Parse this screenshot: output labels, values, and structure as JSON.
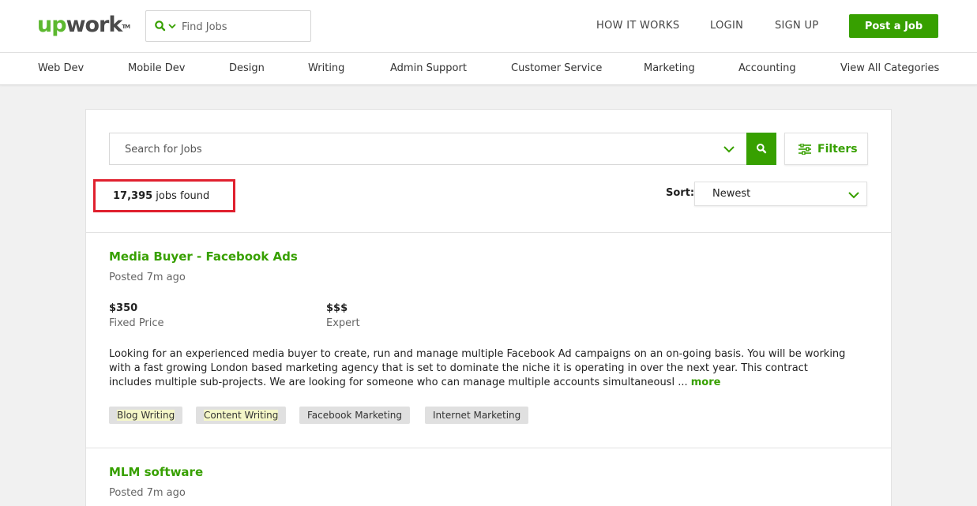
{
  "header": {
    "logo_up": "up",
    "logo_work": "work",
    "logo_tm": "TM",
    "search_placeholder": "Find Jobs",
    "nav": [
      "HOW IT WORKS",
      "LOGIN",
      "SIGN UP"
    ],
    "post_job": "Post a Job"
  },
  "categories": [
    "Web Dev",
    "Mobile Dev",
    "Design",
    "Writing",
    "Admin Support",
    "Customer Service",
    "Marketing",
    "Accounting",
    "View All Categories"
  ],
  "search": {
    "placeholder": "Search for Jobs",
    "filters_label": "Filters"
  },
  "results": {
    "count": "17,395",
    "count_suffix": " jobs found",
    "sort_label": "Sort:",
    "sort_value": "Newest"
  },
  "jobs": [
    {
      "title": "Media Buyer - Facebook Ads",
      "posted": "Posted 7m ago",
      "price": "$350",
      "price_type": "Fixed Price",
      "level_symbol": "$$$",
      "level": "Expert",
      "description": "Looking for an experienced media buyer to create, run and manage multiple Facebook Ad campaigns on an on-going basis. You will be working with a fast growing London based marketing agency that is set to dominate the niche it is operating in over the next year. This contract includes multiple sub-projects. We are looking for someone who can manage multiple accounts simultaneousl ...",
      "more": "more",
      "tags": [
        "Blog Writing",
        "Content Writing",
        "Facebook Marketing",
        "Internet Marketing"
      ]
    },
    {
      "title": "MLM software",
      "posted": "Posted 7m ago"
    }
  ],
  "colors": {
    "brand_green": "#37a000",
    "highlight_red": "#e0202e"
  }
}
